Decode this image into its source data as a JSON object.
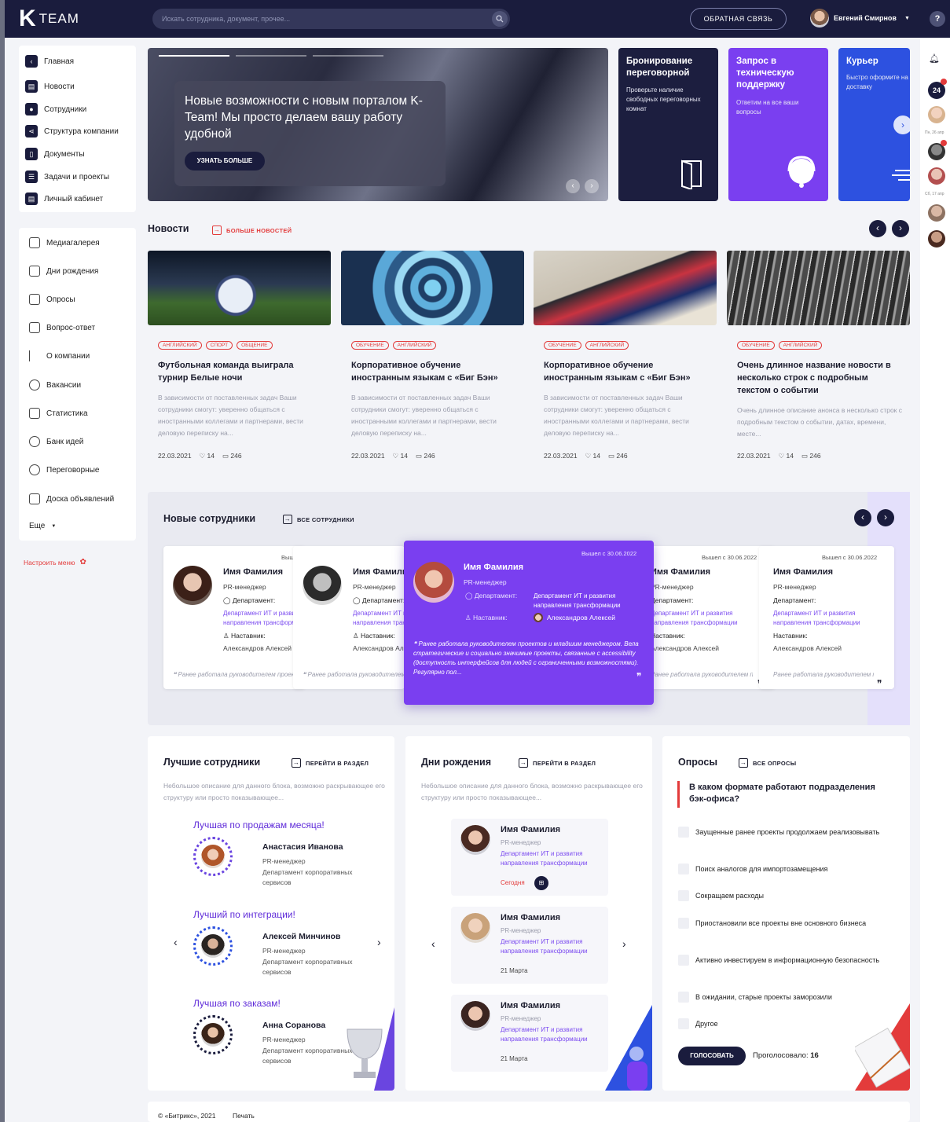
{
  "brand": {
    "logo_letter": "K",
    "logo_text": "TEAM"
  },
  "header": {
    "search_placeholder": "Искать сотрудника, документ, прочее...",
    "feedback": "ОБРАТНАЯ СВЯЗЬ",
    "user_name": "Евгений Смирнов",
    "help": "?"
  },
  "nav_main": [
    "Главная",
    "Новости",
    "Сотрудники",
    "Структура компании",
    "Документы",
    "Задачи и проекты",
    "Личный кабинет"
  ],
  "nav_secondary": [
    "Медиагалерея",
    "Дни рождения",
    "Опросы",
    "Вопрос-ответ",
    "О компании",
    "Вакансии",
    "Статистика",
    "Банк идей",
    "Переговорные",
    "Доска объявлений",
    "Еще"
  ],
  "configure_menu": "Настроить меню",
  "hero": {
    "title": "Новые возможности с новым порталом K-Team! Мы просто делаем вашу работу удобной",
    "button": "УЗНАТЬ БОЛЬШЕ"
  },
  "promos": [
    {
      "title": "Бронирование переговорной",
      "desc": "Проверьте наличие свободных переговорных комнат",
      "color": "#1c1e3f"
    },
    {
      "title": "Запрос в техническую поддержку",
      "desc": "Ответим на все ваши вопросы",
      "color": "#7a3ff0"
    },
    {
      "title": "Курьер",
      "desc": "Быстро оформите на доставку",
      "color": "#2d51e0"
    }
  ],
  "right_rail": {
    "notif_count": "24",
    "date1": "Пн, 26 апр",
    "date2": "Сб, 17 апр"
  },
  "news": {
    "title": "Новости",
    "more": "БОЛЬШЕ НОВОСТЕЙ",
    "items": [
      {
        "tags": [
          "английский",
          "спорт",
          "общение"
        ],
        "title": "Футбольная команда выиграла турнир Белые ночи",
        "desc": "В зависимости от поставленных задач Ваши сотрудники смогут: уверенно общаться с иностранными коллегами и партнерами, вести деловую переписку на...",
        "date": "22.03.2021",
        "likes": "14",
        "comments": "246"
      },
      {
        "tags": [
          "обучение",
          "английский"
        ],
        "title": "Корпоративное обучение иностранным языкам с «Биг Бэн»",
        "desc": "В зависимости от поставленных задач Ваши сотрудники смогут: уверенно общаться с иностранными коллегами и партнерами, вести деловую переписку на...",
        "date": "22.03.2021",
        "likes": "14",
        "comments": "246"
      },
      {
        "tags": [
          "обучение",
          "английский"
        ],
        "title": "Корпоративное обучение иностранным языкам с «Биг Бэн»",
        "desc": "В зависимости от поставленных задач Ваши сотрудники смогут: уверенно общаться с иностранными коллегами и партнерами, вести деловую переписку на...",
        "date": "22.03.2021",
        "likes": "14",
        "comments": "246"
      },
      {
        "tags": [
          "обучение",
          "английский"
        ],
        "title": "Очень длинное название новости в несколько строк с подробным текстом о событии",
        "desc": "Очень длинное описание анонса в несколько строк с подробным текстом о событии, датах, времени, месте...",
        "date": "22.03.2021",
        "likes": "14",
        "comments": "246"
      }
    ]
  },
  "employees": {
    "title": "Новые сотрудники",
    "all": "ВСЕ СОТРУДНИКИ",
    "name": "Имя Фамилия",
    "position": "PR-менеджер",
    "dept_label": "Департамент:",
    "dept": "Департамент ИТ и развития направления трансформации",
    "mentor_label": "Наставник:",
    "mentor": "Александров Алексей",
    "since": "Вышел с 30.06.2022",
    "quote": "Ранее работала руководителем проектов и младшим менеджером. Вела стратегические и социально значимые проекты, связанные с accessibility (доступность интерфейсов для людей с ограниченными возможностями). Регулярно пол...",
    "quote_short": "Ранее работала руководителем проектов и младшим менеджером. Вела стратегическ..."
  },
  "best": {
    "title": "Лучшие сотрудники",
    "link": "ПЕРЕЙТИ В РАЗДЕЛ",
    "desc": "Небольшое описание для данного блока, возможно раскрывающее его структуру или просто показывающее...",
    "items": [
      {
        "award": "Лучшая по продажам месяца!",
        "name": "Анастасия Иванова",
        "pos": "PR-менеджер",
        "dept": "Департамент корпоративных сервисов"
      },
      {
        "award": "Лучший по интеграции!",
        "name": "Алексей Минчинов",
        "pos": "PR-менеджер",
        "dept": "Департамент корпоративных сервисов"
      },
      {
        "award": "Лучшая по заказам!",
        "name": "Анна Соранова",
        "pos": "PR-менеджер",
        "dept": "Департамент корпоративных сервисов"
      }
    ]
  },
  "birthdays": {
    "title": "Дни рождения",
    "link": "ПЕРЕЙТИ В РАЗДЕЛ",
    "desc": "Небольшое описание для данного блока, возможно раскрывающее его структуру или просто показывающее...",
    "items": [
      {
        "name": "Имя Фамилия",
        "pos": "PR-менеджер",
        "dept": "Департамент ИТ и развития направления трансформации",
        "date": "Сегодня"
      },
      {
        "name": "Имя Фамилия",
        "pos": "PR-менеджер",
        "dept": "Департамент ИТ и развития направления трансформации",
        "date": "21 Марта"
      },
      {
        "name": "Имя Фамилия",
        "pos": "PR-менеджер",
        "dept": "Департамент ИТ и развития направления трансформации",
        "date": "21 Марта"
      }
    ]
  },
  "polls": {
    "title": "Опросы",
    "link": "ВСЕ ОПРОСЫ",
    "question": "В каком формате работают подразделения бэк-офиса?",
    "options": [
      "Заущенные ранее проекты продолжаем реализовывать",
      "Поиск аналогов для импортозамещения",
      "Сокращаем расходы",
      "Приостановили все проекты вне основного бизнеса",
      "Активно инвестируем в информационную безопасность",
      "В ожидании, старые проекты заморозили",
      "Другое"
    ],
    "vote": "ГОЛОСОВАТЬ",
    "voted_label": "Проголосовало:",
    "voted_count": "16"
  },
  "footer": {
    "copyright": "© «Битрикс», 2021",
    "print": "Печать"
  }
}
